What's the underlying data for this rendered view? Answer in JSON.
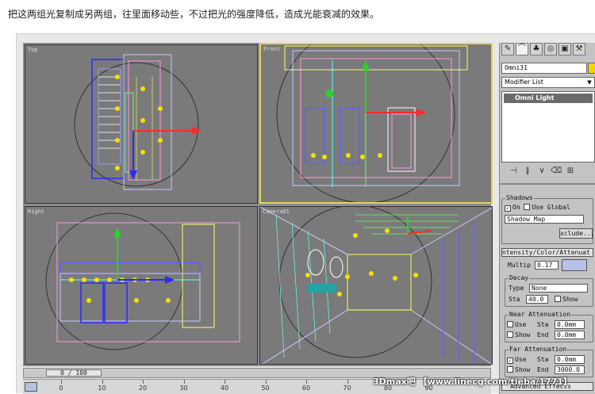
{
  "caption": "把这两组光复制成另两组，往里面移动些，不过把光的强度降低，造成光能衰减的效果。",
  "viewports": {
    "top": "Top",
    "front": "Front",
    "right": "Right",
    "camera": "Camera01"
  },
  "timeline": {
    "slider": "0 / 100",
    "ticks": [
      "0",
      "10",
      "20",
      "30",
      "40",
      "50",
      "60",
      "70",
      "80",
      "90"
    ]
  },
  "panel": {
    "tabs": [
      "create-tab-icon",
      "modify-tab-icon",
      "hierarchy-tab-icon",
      "motion-tab-icon",
      "display-tab-icon",
      "utilities-tab-icon"
    ],
    "object_name": "Omni31",
    "object_color": "#f2d300",
    "modifier_list": "Modifier List",
    "stack_item": "Omni Light",
    "shadows": {
      "title": "Shadows",
      "on_label": "On",
      "on_checked": true,
      "use_global_label": "Use Global",
      "use_global_checked": false,
      "type": "Shadow Map",
      "exclude_button": "xclude..."
    },
    "intensity": {
      "rollout_title": "ntensity/Color/Attenuat",
      "multiplier_label": "Multip",
      "multiplier_value": "0.17",
      "color": "#b6c2ea"
    },
    "decay": {
      "title": "Decay",
      "type_label": "Type",
      "type_value": "None",
      "start_label": "Sta",
      "start_value": "40.0",
      "show_label": "Show",
      "show_checked": false
    },
    "near_attenuation": {
      "title": "Near Attenuation",
      "use_label": "Use",
      "use_checked": false,
      "show_label": "Show",
      "show_checked": false,
      "start_label": "Sta",
      "start_value": "0.0mm",
      "end_label": "End",
      "end_value": "0.0mm"
    },
    "far_attenuation": {
      "title": "Far Attenuation",
      "use_label": "Use",
      "use_checked": true,
      "show_label": "Show",
      "show_checked": false,
      "start_label": "Sta",
      "start_value": "0.0mm",
      "end_label": "End",
      "end_value": "3000.0"
    },
    "advanced_effects": "Advanced Effects"
  },
  "watermark": "3Dmax吧 【www.linecg.com/tieba/1771】"
}
